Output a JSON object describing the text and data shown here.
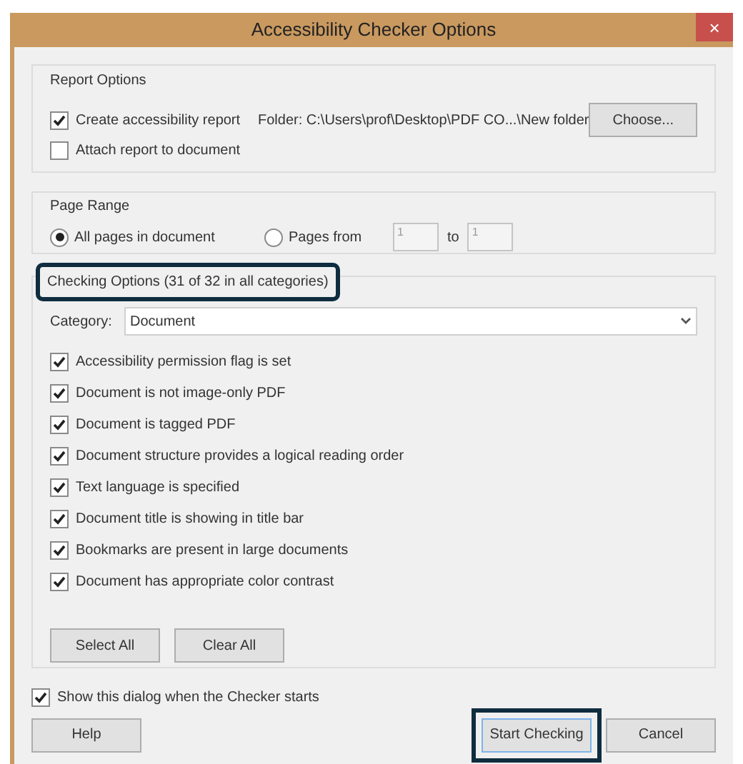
{
  "window": {
    "title": "Accessibility Checker Options",
    "close": "×"
  },
  "report_options": {
    "title": "Report Options",
    "create_report": {
      "label": "Create accessibility report",
      "checked": true
    },
    "folder": "Folder: C:\\Users\\prof\\Desktop\\PDF CO...\\New folder",
    "choose_button": "Choose...",
    "attach_report": {
      "label": "Attach report to document",
      "checked": false
    }
  },
  "page_range": {
    "title": "Page Range",
    "options": [
      {
        "label": "All pages in document",
        "selected": true
      },
      {
        "label": "Pages from",
        "selected": false
      }
    ],
    "from": "1",
    "to_label": "to",
    "to": "1"
  },
  "checking_options": {
    "title": "Checking Options (31 of 32 in all categories)",
    "highlighted": true,
    "category_label": "Category:",
    "category": "Document",
    "checks": [
      {
        "label": "Accessibility permission flag is set",
        "checked": true
      },
      {
        "label": "Document is not image-only PDF",
        "checked": true
      },
      {
        "label": "Document is tagged PDF",
        "checked": true
      },
      {
        "label": "Document structure provides a logical reading order",
        "checked": true
      },
      {
        "label": "Text language is specified",
        "checked": true
      },
      {
        "label": "Document title is showing in title bar",
        "checked": true
      },
      {
        "label": "Bookmarks are present in large documents",
        "checked": true
      },
      {
        "label": "Document has appropriate color contrast",
        "checked": true
      }
    ],
    "buttons": [
      "Select All",
      "Clear All"
    ]
  },
  "show_dialog": {
    "label": "Show this dialog when the Checker starts",
    "checked": true
  },
  "buttons": [
    {
      "label": "Help",
      "highlighted": false
    },
    {
      "label": "Start Checking",
      "highlighted": true
    },
    {
      "label": "Cancel",
      "highlighted": false
    }
  ]
}
